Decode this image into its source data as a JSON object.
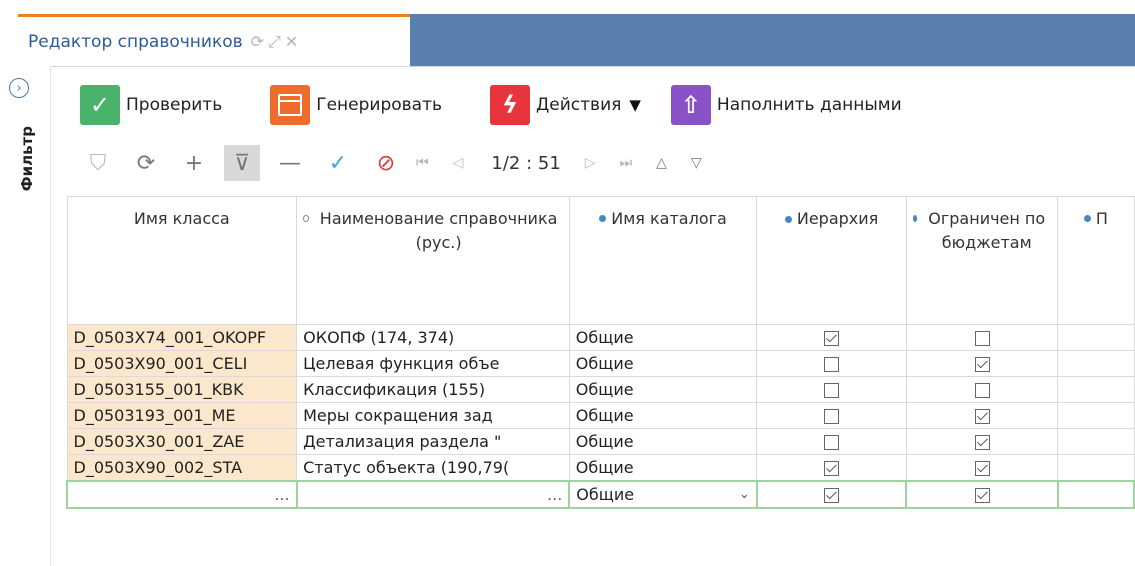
{
  "window": {
    "tab_title": "Редактор справочников",
    "tab_icons": [
      "refresh-icon",
      "expand-icon",
      "close-icon"
    ]
  },
  "filter_panel": {
    "label": "Фильтр"
  },
  "toolbar": {
    "check_label": "Проверить",
    "generate_label": "Генерировать",
    "actions_label": "Действия",
    "fill_label": "Наполнить данными"
  },
  "pager": {
    "text": "1/2 : 51"
  },
  "grid": {
    "columns": [
      "Имя класса",
      "Наименование справочника (рус.)",
      "Имя каталога",
      "Иерархия",
      "Ограничен по бюджетам",
      "П"
    ],
    "rows": [
      {
        "cls": "D_0503X74_001_OKOPF",
        "name": "ОКОПФ (174, 374)",
        "catalog": "Общие",
        "hier": true,
        "limit": false
      },
      {
        "cls": "D_0503X90_001_CELI",
        "name": "Целевая функция объе",
        "catalog": "Общие",
        "hier": false,
        "limit": true
      },
      {
        "cls": "D_0503155_001_KBK",
        "name": "Классификация (155)",
        "catalog": "Общие",
        "hier": false,
        "limit": false
      },
      {
        "cls": "D_0503193_001_ME",
        "name": "Меры сокращения зад",
        "catalog": "Общие",
        "hier": false,
        "limit": true
      },
      {
        "cls": "D_0503X30_001_ZAE",
        "name": "Детализация раздела \"",
        "catalog": "Общие",
        "hier": false,
        "limit": true
      },
      {
        "cls": "D_0503X90_002_STA",
        "name": "Статус объекта (190,79(",
        "catalog": "Общие",
        "hier": true,
        "limit": true
      }
    ],
    "new_row": {
      "cls": "...",
      "name": "...",
      "catalog": "Общие",
      "hier": true,
      "limit": true
    }
  }
}
